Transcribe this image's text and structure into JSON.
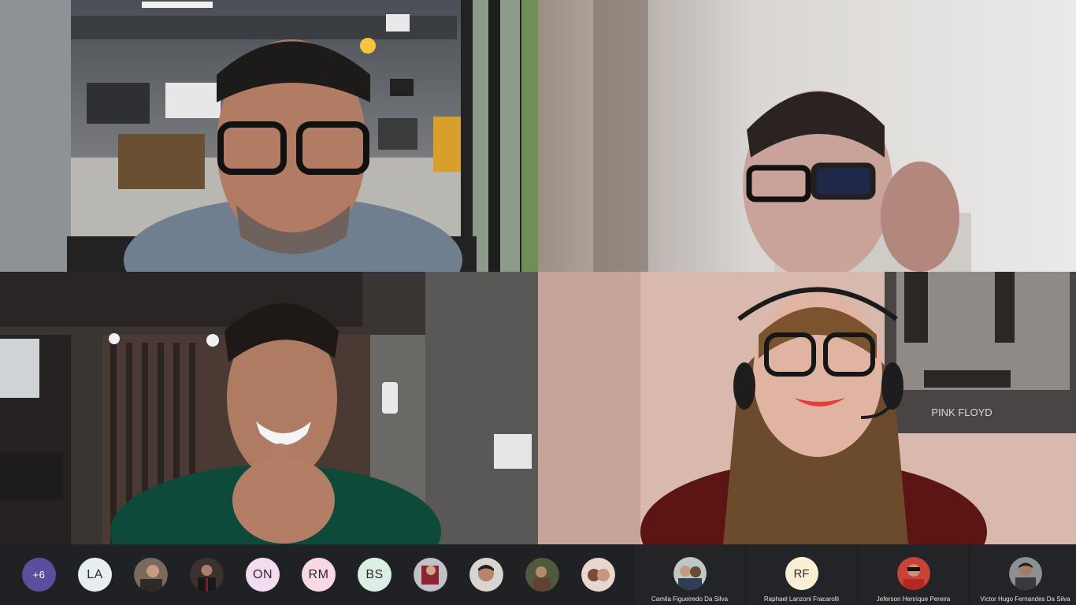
{
  "app": {
    "title": ""
  },
  "video_tiles": [
    {
      "participant": "participant-1"
    },
    {
      "participant": "participant-2"
    },
    {
      "participant": "participant-3"
    },
    {
      "participant": "participant-4"
    }
  ],
  "strip": {
    "overflow_count": "+6",
    "bubbles": [
      {
        "type": "initials",
        "text": "LA",
        "bg": "#e7eef0"
      },
      {
        "type": "photo",
        "icon": "avatar-photo"
      },
      {
        "type": "photo",
        "icon": "avatar-photo"
      },
      {
        "type": "initials",
        "text": "ON",
        "bg": "#f3dcef"
      },
      {
        "type": "initials",
        "text": "RM",
        "bg": "#f9d7e5"
      },
      {
        "type": "initials",
        "text": "BS",
        "bg": "#dcefe5"
      },
      {
        "type": "photo",
        "icon": "avatar-photo"
      },
      {
        "type": "photo",
        "icon": "avatar-photo"
      },
      {
        "type": "photo",
        "icon": "avatar-photo"
      },
      {
        "type": "photo",
        "icon": "avatar-photo"
      }
    ],
    "named": [
      {
        "name": "Camila Figueiredo Da Silva",
        "type": "photo"
      },
      {
        "name": "Raphael Lanzoni Fracarolli",
        "type": "initials",
        "text": "RF",
        "bg": "#f8efd4"
      },
      {
        "name": "Jeferson Henrique Pereira",
        "type": "photo"
      },
      {
        "name": "Victor Hugo Fernandes Da Silva",
        "type": "photo"
      }
    ]
  },
  "wall_text": "PINK FLOYD",
  "colors": {
    "strip_bg": "#202124",
    "more_bubble": "#5b4e9c"
  }
}
